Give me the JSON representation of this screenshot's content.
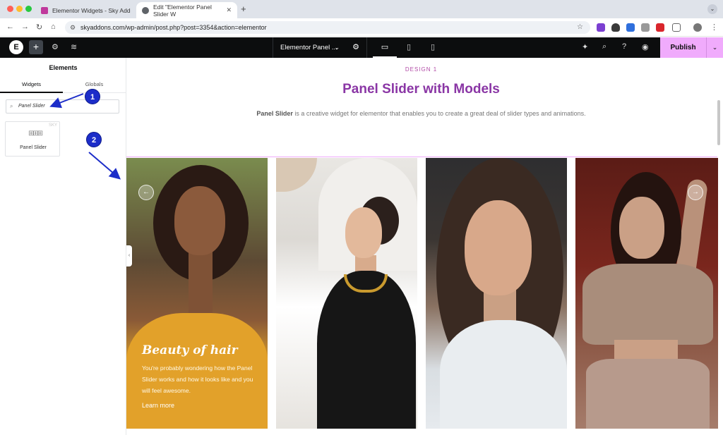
{
  "browser": {
    "tabs": [
      {
        "label": "Elementor Widgets - Sky Add"
      },
      {
        "label": "Edit \"Elementor Panel Slider W"
      }
    ],
    "url": "skyaddons.com/wp-admin/post.php?post=3354&action=elementor"
  },
  "editor": {
    "document_title": "Elementor Panel ...",
    "publish_label": "Publish"
  },
  "panel": {
    "title": "Elements",
    "tabs": [
      "Widgets",
      "Globals"
    ],
    "search_value": "Panel Slider",
    "widget": {
      "label": "Panel Slider",
      "pro_badge": "SKY"
    }
  },
  "page": {
    "eyebrow": "DESIGN 1",
    "title": "Panel Slider with Models",
    "description_bold": "Panel Slider",
    "description_rest": " is a creative widget for elementor that enables you to create a great deal of slider types and animations."
  },
  "slide1": {
    "title": "Beauty of hair",
    "text": "You're probably wondering how the Panel Slider works and how it looks like and you will feel awesome.",
    "link": "Learn more"
  },
  "annotations": {
    "step1": "1",
    "step2": "2"
  },
  "colors": {
    "accent": "#8a36a5",
    "publish": "#f0abfc",
    "badge": "#1c2dc9"
  }
}
